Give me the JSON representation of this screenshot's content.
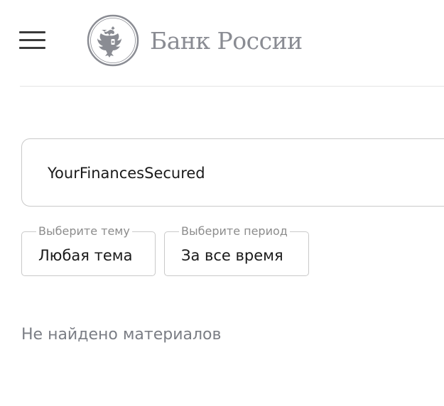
{
  "header": {
    "logo_text": "Банк России"
  },
  "search": {
    "value": "YourFinancesSecured"
  },
  "filters": {
    "theme": {
      "label": "Выберите тему",
      "value": "Любая тема"
    },
    "period": {
      "label": "Выберите период",
      "value": "За все время"
    }
  },
  "results": {
    "empty_message": "Не найдено материалов"
  },
  "colors": {
    "logo_gray": "#8a8c93",
    "border": "#c9c9c9",
    "muted_text": "#7b7e85"
  }
}
